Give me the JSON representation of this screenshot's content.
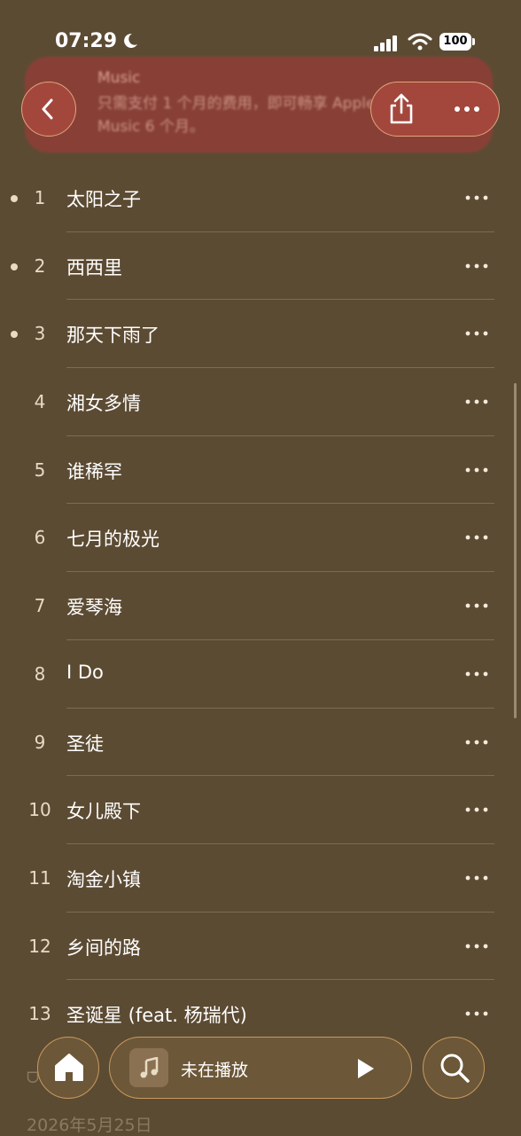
{
  "status_bar": {
    "time": "07:29",
    "battery": "100"
  },
  "notification": {
    "app": "Music",
    "text": "只需支付 1 个月的费用，即可畅享 Apple Music 6 个月。"
  },
  "tracks": [
    {
      "number": "1",
      "title": "太阳之子",
      "downloaded": true
    },
    {
      "number": "2",
      "title": "西西里",
      "downloaded": true
    },
    {
      "number": "3",
      "title": "那天下雨了",
      "downloaded": true
    },
    {
      "number": "4",
      "title": "湘女多情",
      "downloaded": false
    },
    {
      "number": "5",
      "title": "谁稀罕",
      "downloaded": false
    },
    {
      "number": "6",
      "title": "七月的极光",
      "downloaded": false
    },
    {
      "number": "7",
      "title": "爱琴海",
      "downloaded": false
    },
    {
      "number": "8",
      "title": "I Do",
      "downloaded": false
    },
    {
      "number": "9",
      "title": "圣徒",
      "downloaded": false
    },
    {
      "number": "10",
      "title": "女儿殿下",
      "downloaded": false
    },
    {
      "number": "11",
      "title": "淘金小镇",
      "downloaded": false
    },
    {
      "number": "12",
      "title": "乡间的路",
      "downloaded": false
    },
    {
      "number": "13",
      "title": "圣诞星 (feat. 杨瑞代)",
      "downloaded": false
    }
  ],
  "footer": {
    "date": "2026年5月25日"
  },
  "mini_player": {
    "status": "未在播放"
  },
  "colors": {
    "background": "#5c4b33",
    "accent_button": "#a3473d",
    "border_gold": "#c99a5c"
  },
  "icons": [
    "back-chevron-icon",
    "share-icon",
    "more-icon",
    "home-icon",
    "music-note-icon",
    "play-icon",
    "search-icon"
  ]
}
